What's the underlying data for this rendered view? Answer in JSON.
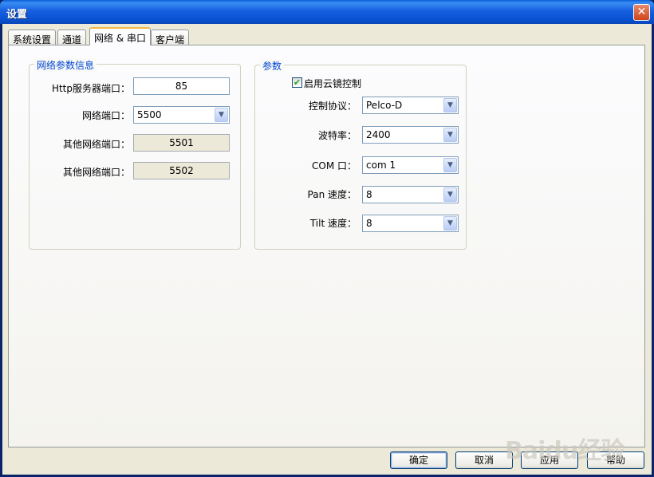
{
  "window": {
    "title": "设置",
    "close_glyph": "✕"
  },
  "tabs": [
    {
      "label": "系统设置"
    },
    {
      "label": "通道"
    },
    {
      "label": "网络 & 串口"
    },
    {
      "label": "客户端"
    }
  ],
  "network_group": {
    "title": "网络参数信息",
    "http_port_label": "Http服务器端口：",
    "http_port_value": "85",
    "net_port_label": "网络端口：",
    "net_port_value": "5500",
    "other_port1_label": "其他网络端口：",
    "other_port1_value": "5501",
    "other_port2_label": "其他网络端口：",
    "other_port2_value": "5502"
  },
  "params_group": {
    "title": "参数",
    "enable_ptz_label": "启用云镜控制",
    "enable_ptz_checked": true,
    "protocol_label": "控制协议：",
    "protocol_value": "Pelco-D",
    "baud_label": "波特率：",
    "baud_value": "2400",
    "com_label": "COM 口：",
    "com_value": "com 1",
    "pan_label": "Pan 速度：",
    "pan_value": "8",
    "tilt_label": "Tilt 速度：",
    "tilt_value": "8"
  },
  "buttons": {
    "ok": "确定",
    "cancel": "取消",
    "apply": "应用",
    "help": "帮助"
  },
  "watermark": "Baidu经验",
  "icons": {
    "dropdown": "chevron-down-icon",
    "check": "checkmark-icon",
    "close": "close-icon"
  }
}
